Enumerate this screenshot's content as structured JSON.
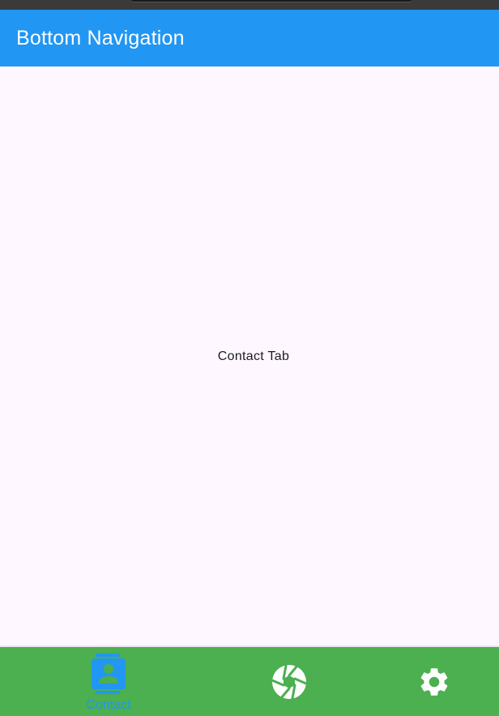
{
  "app_bar": {
    "title": "Bottom Navigation"
  },
  "body": {
    "text": "Contact Tab"
  },
  "bottom_nav": {
    "items": [
      {
        "label": "Contact",
        "icon": "contact-icon",
        "selected": true
      },
      {
        "label": "",
        "icon": "camera-aperture-icon",
        "selected": false
      },
      {
        "label": "",
        "icon": "settings-gear-icon",
        "selected": false
      }
    ]
  },
  "colors": {
    "app_bar": "#2196f3",
    "bottom_nav": "#4caf50",
    "selected_item": "#2196f3",
    "unselected_item": "#ffffff",
    "body_bg": "#fef7ff"
  }
}
